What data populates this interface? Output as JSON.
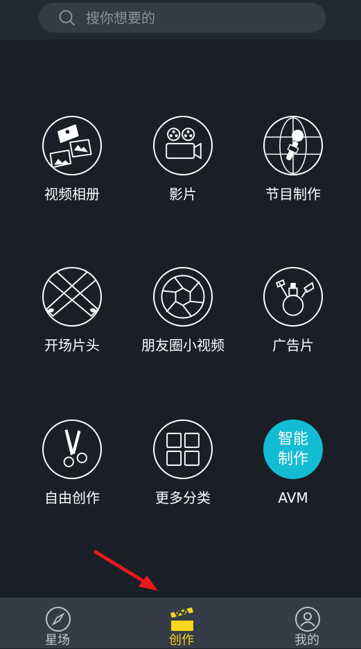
{
  "search": {
    "placeholder": "搜你想要的"
  },
  "grid": {
    "items": [
      {
        "label": "视频相册",
        "icon": "photo-album-icon"
      },
      {
        "label": "影片",
        "icon": "film-camera-icon"
      },
      {
        "label": "节目制作",
        "icon": "microphone-globe-icon"
      },
      {
        "label": "开场片头",
        "icon": "spotlights-icon"
      },
      {
        "label": "朋友圈小视频",
        "icon": "aperture-icon"
      },
      {
        "label": "广告片",
        "icon": "perfume-bottle-icon"
      },
      {
        "label": "自由创作",
        "icon": "scissors-icon"
      },
      {
        "label": "更多分类",
        "icon": "grid-icon"
      },
      {
        "label": "AVM",
        "icon_text_line1": "智能",
        "icon_text_line2": "制作"
      }
    ]
  },
  "tabbar": {
    "tabs": [
      {
        "label": "星场",
        "icon": "compass-icon",
        "active": false
      },
      {
        "label": "创作",
        "icon": "clapperboard-icon",
        "active": true
      },
      {
        "label": "我的",
        "icon": "user-icon",
        "active": false
      }
    ]
  },
  "colors": {
    "background": "#1a1f27",
    "accent": "#13bcd3",
    "active_tab": "#f5d61c",
    "annotation_arrow": "#e8191b"
  }
}
